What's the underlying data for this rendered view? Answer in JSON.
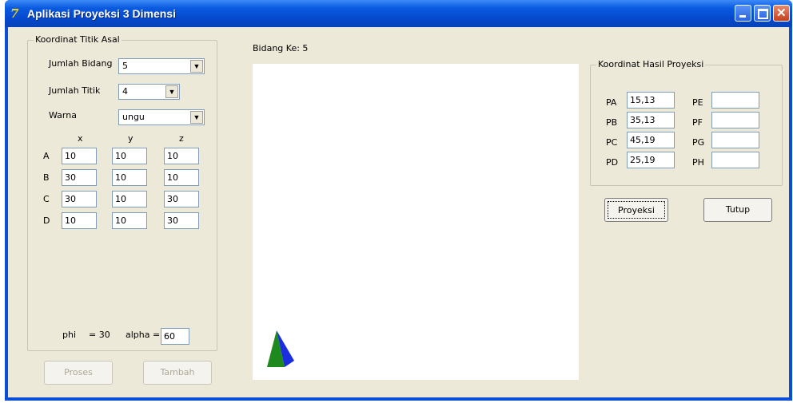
{
  "window": {
    "title": "Aplikasi Proyeksi 3 Dimensi",
    "icon": "7-logo-icon",
    "accent": "#0a4ed8"
  },
  "left_group": {
    "title": "Koordinat Titik Asal",
    "jumlah_bidang_label": "Jumlah Bidang",
    "jumlah_bidang_value": "5",
    "jumlah_titik_label": "Jumlah Titik",
    "jumlah_titik_value": "4",
    "warna_label": "Warna",
    "warna_value": "ungu",
    "col_x": "x",
    "col_y": "y",
    "col_z": "z",
    "rows": [
      {
        "label": "A",
        "x": "10",
        "y": "10",
        "z": "10"
      },
      {
        "label": "B",
        "x": "30",
        "y": "10",
        "z": "10"
      },
      {
        "label": "C",
        "x": "30",
        "y": "10",
        "z": "30"
      },
      {
        "label": "D",
        "x": "10",
        "y": "10",
        "z": "30"
      }
    ],
    "phi_label": "phi",
    "phi_value": "= 30",
    "alpha_label": "alpha =",
    "alpha_value": "60"
  },
  "buttons": {
    "proses": "Proses",
    "tambah": "Tambah",
    "proyeksi": "Proyeksi",
    "tutup": "Tutup"
  },
  "canvas": {
    "bidang_label": "Bidang Ke: 5",
    "shape_colors": [
      "#1e8a1e",
      "#1a2ee0"
    ]
  },
  "right_group": {
    "title": "Koordinat Hasil Proyeksi",
    "left_items": [
      {
        "label": "PA",
        "value": "15,13"
      },
      {
        "label": "PB",
        "value": "35,13"
      },
      {
        "label": "PC",
        "value": "45,19"
      },
      {
        "label": "PD",
        "value": "25,19"
      }
    ],
    "right_items": [
      {
        "label": "PE",
        "value": ""
      },
      {
        "label": "PF",
        "value": ""
      },
      {
        "label": "PG",
        "value": ""
      },
      {
        "label": "PH",
        "value": ""
      }
    ]
  }
}
